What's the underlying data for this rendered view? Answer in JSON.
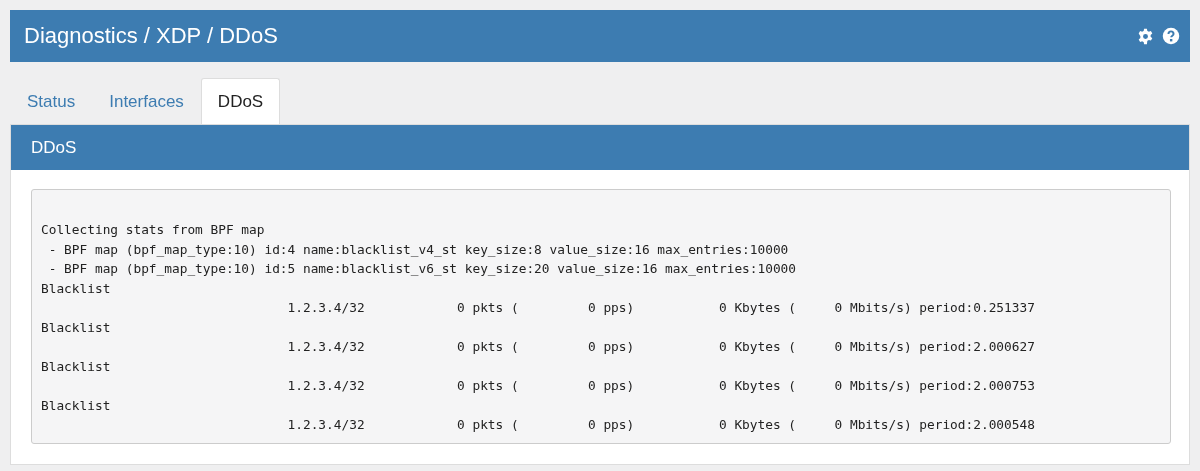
{
  "header": {
    "title": "Diagnostics / XDP / DDoS"
  },
  "tabs": [
    {
      "label": "Status",
      "selected": false
    },
    {
      "label": "Interfaces",
      "selected": false
    },
    {
      "label": "DDoS",
      "selected": true
    }
  ],
  "panel": {
    "title": "DDoS",
    "output_lines": [
      "Collecting stats from BPF map",
      " - BPF map (bpf_map_type:10) id:4 name:blacklist_v4_st key_size:8 value_size:16 max_entries:10000",
      " - BPF map (bpf_map_type:10) id:5 name:blacklist_v6_st key_size:20 value_size:16 max_entries:10000",
      "Blacklist",
      "                                1.2.3.4/32            0 pkts (         0 pps)           0 Kbytes (     0 Mbits/s) period:0.251337",
      "Blacklist",
      "                                1.2.3.4/32            0 pkts (         0 pps)           0 Kbytes (     0 Mbits/s) period:2.000627",
      "Blacklist",
      "                                1.2.3.4/32            0 pkts (         0 pps)           0 Kbytes (     0 Mbits/s) period:2.000753",
      "Blacklist",
      "                                1.2.3.4/32            0 pkts (         0 pps)           0 Kbytes (     0 Mbits/s) period:2.000548"
    ]
  }
}
